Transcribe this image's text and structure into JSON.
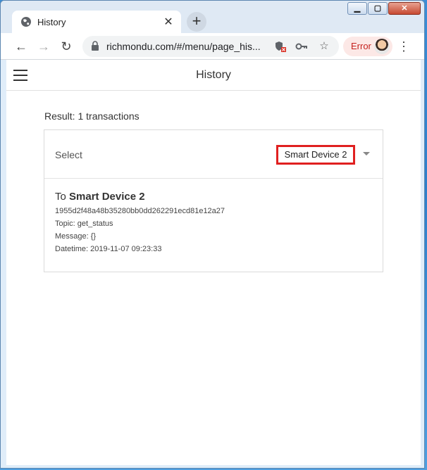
{
  "browser": {
    "tab_title": "History",
    "tab_close": "✕",
    "new_tab": "+",
    "url": "richmondu.com/#/menu/page_his...",
    "error_label": "Error"
  },
  "app": {
    "title": "History",
    "result_text": "Result: 1 transactions",
    "select_label": "Select",
    "select_value": "Smart Device 2"
  },
  "transaction": {
    "to_prefix": "To",
    "device": "Smart Device 2",
    "hash": "1955d2f48a48b35280bb0dd262291ecd81e12a27",
    "topic": "Topic: get_status",
    "message": "Message: {}",
    "datetime": "Datetime: 2019-11-07 09:23:33"
  },
  "colors": {
    "highlight": "#e02020",
    "error_text": "#c5221f",
    "error_bg": "#fce8e6"
  }
}
